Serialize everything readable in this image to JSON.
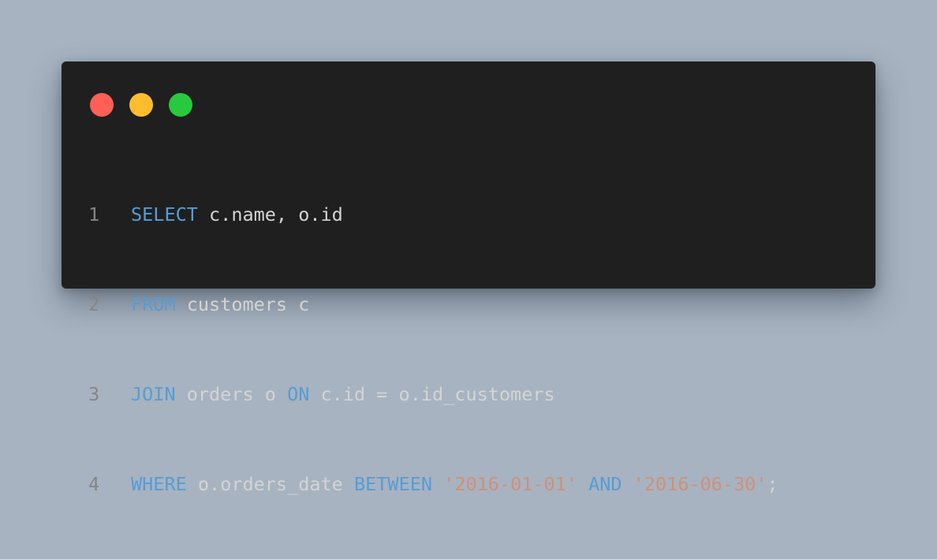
{
  "colors": {
    "background": "#a7b3c1",
    "window": "#1f1f1f",
    "dot_close": "#ff5f56",
    "dot_minimize": "#ffbd2e",
    "dot_zoom": "#27c93f",
    "keyword": "#569cd6",
    "string": "#ce9178",
    "plain": "#d4d4d4",
    "line_number": "#858585"
  },
  "window_controls": [
    "close",
    "minimize",
    "zoom"
  ],
  "code": {
    "lines": [
      {
        "number": "1",
        "tokens": [
          {
            "type": "keyword",
            "text": "SELECT"
          },
          {
            "type": "plain",
            "text": " c.name, o.id"
          }
        ]
      },
      {
        "number": "2",
        "tokens": [
          {
            "type": "keyword",
            "text": "FROM"
          },
          {
            "type": "plain",
            "text": " customers c"
          }
        ]
      },
      {
        "number": "3",
        "tokens": [
          {
            "type": "keyword",
            "text": "JOIN"
          },
          {
            "type": "plain",
            "text": " orders o "
          },
          {
            "type": "keyword",
            "text": "ON"
          },
          {
            "type": "plain",
            "text": " c.id = o.id_customers"
          }
        ]
      },
      {
        "number": "4",
        "tokens": [
          {
            "type": "keyword",
            "text": "WHERE"
          },
          {
            "type": "plain",
            "text": " o.orders_date "
          },
          {
            "type": "keyword",
            "text": "BETWEEN"
          },
          {
            "type": "plain",
            "text": " "
          },
          {
            "type": "string",
            "text": "'2016-01-01'"
          },
          {
            "type": "plain",
            "text": " "
          },
          {
            "type": "keyword",
            "text": "AND"
          },
          {
            "type": "plain",
            "text": " "
          },
          {
            "type": "string",
            "text": "'2016-06-30'"
          },
          {
            "type": "plain",
            "text": ";"
          }
        ]
      }
    ]
  }
}
